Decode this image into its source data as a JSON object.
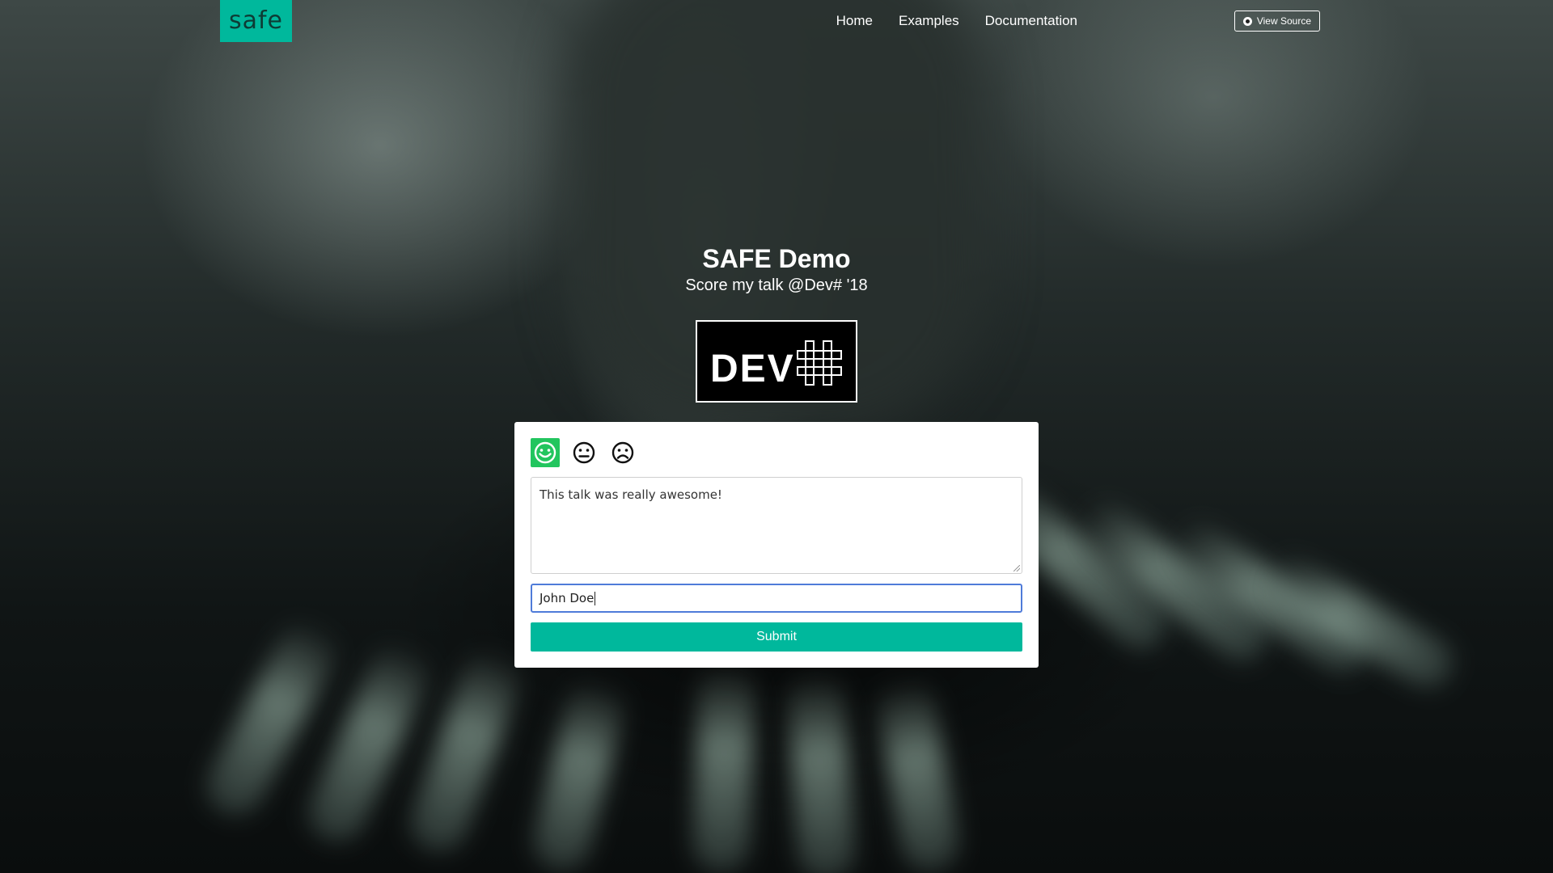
{
  "nav": {
    "logo_text": "safe",
    "links": [
      "Home",
      "Examples",
      "Documentation"
    ],
    "view_source_label": "View Source"
  },
  "hero": {
    "title": "SAFE Demo",
    "subtitle": "Score my talk @Dev# '18",
    "event_logo_text": "DEV"
  },
  "feedback": {
    "ratings": [
      {
        "icon": "happy-face-icon",
        "selected": true
      },
      {
        "icon": "neutral-face-icon",
        "selected": false
      },
      {
        "icon": "sad-face-icon",
        "selected": false
      }
    ],
    "comment_value": "This talk was really awesome!",
    "name_value": "John Doe",
    "submit_label": "Submit"
  },
  "colors": {
    "brand": "#00b89c",
    "selected_rating": "#22c55e",
    "focus_border": "#4f7bd9"
  }
}
